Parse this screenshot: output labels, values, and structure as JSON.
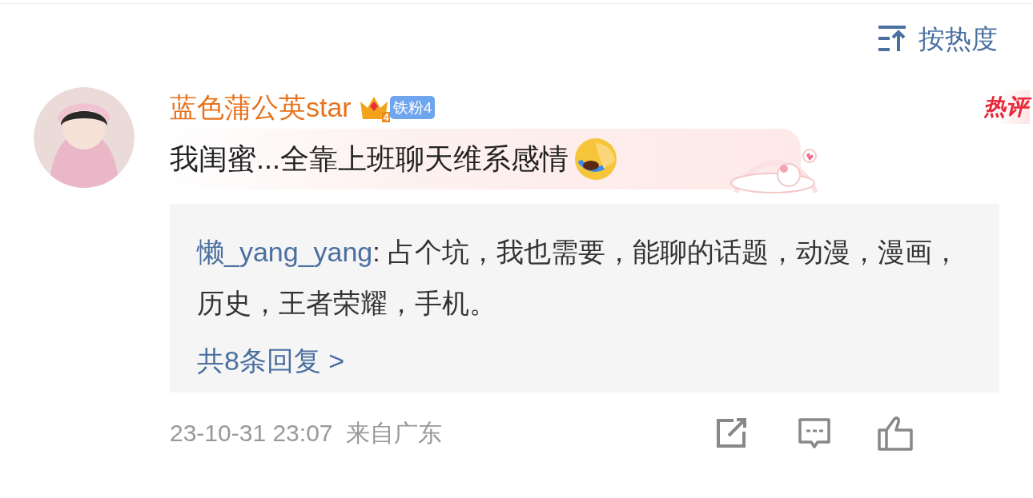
{
  "sort": {
    "label": "按热度"
  },
  "comment": {
    "username": "蓝色蒲公英star",
    "crown_level": "4",
    "fan_badge": "铁粉4",
    "hot_tag": "热评",
    "text": "我闺蜜...全靠上班聊天维系感情",
    "reply_preview": {
      "author": "懒_yang_yang",
      "text": ": 占个坑，我也需要，能聊的话题，动漫，漫画，历史，王者荣耀，手机。",
      "more": "共8条回复 >"
    },
    "time": "23-10-31 23:07",
    "location": "来自广东"
  }
}
